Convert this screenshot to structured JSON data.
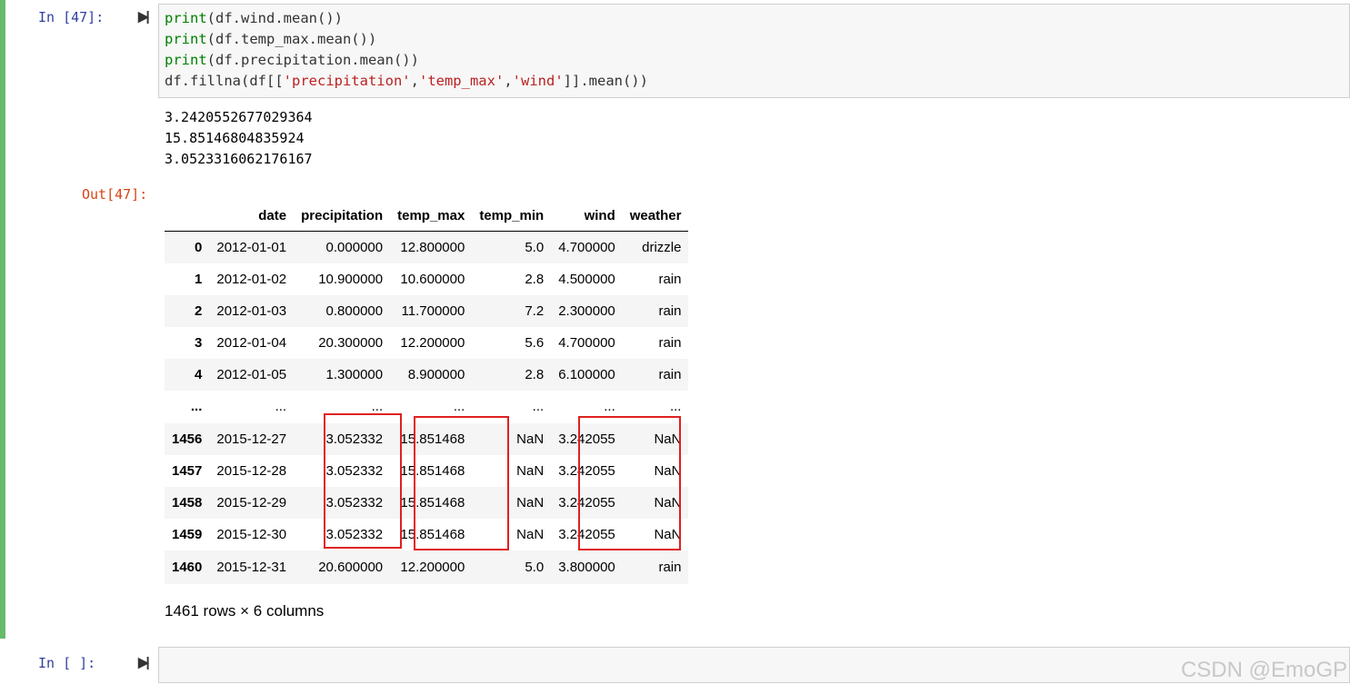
{
  "cell1": {
    "prompt_in": "In  [47]:",
    "prompt_out": "Out[47]:",
    "run_icon": "run-cell-icon",
    "code": {
      "line1": {
        "fn": "print",
        "rest": "(df.wind.mean())"
      },
      "line2": {
        "fn": "print",
        "rest": "(df.temp_max.mean())"
      },
      "line3": {
        "fn": "print",
        "rest": "(df.precipitation.mean())"
      },
      "line4": {
        "p1": "df.fillna(df[[",
        "s1": "'precipitation'",
        "c1": ",",
        "s2": "'temp_max'",
        "c2": ",",
        "s3": "'wind'",
        "p2": "]].mean())"
      }
    },
    "stdout": [
      "3.2420552677029364",
      "15.85146804835924",
      "3.0523316062176167"
    ],
    "table": {
      "columns": [
        "",
        "date",
        "precipitation",
        "temp_max",
        "temp_min",
        "wind",
        "weather"
      ],
      "rows": [
        [
          "0",
          "2012-01-01",
          "0.000000",
          "12.800000",
          "5.0",
          "4.700000",
          "drizzle"
        ],
        [
          "1",
          "2012-01-02",
          "10.900000",
          "10.600000",
          "2.8",
          "4.500000",
          "rain"
        ],
        [
          "2",
          "2012-01-03",
          "0.800000",
          "11.700000",
          "7.2",
          "2.300000",
          "rain"
        ],
        [
          "3",
          "2012-01-04",
          "20.300000",
          "12.200000",
          "5.6",
          "4.700000",
          "rain"
        ],
        [
          "4",
          "2012-01-05",
          "1.300000",
          "8.900000",
          "2.8",
          "6.100000",
          "rain"
        ],
        [
          "...",
          "...",
          "...",
          "...",
          "...",
          "...",
          "..."
        ],
        [
          "1456",
          "2015-12-27",
          "3.052332",
          "15.851468",
          "NaN",
          "3.242055",
          "NaN"
        ],
        [
          "1457",
          "2015-12-28",
          "3.052332",
          "15.851468",
          "NaN",
          "3.242055",
          "NaN"
        ],
        [
          "1458",
          "2015-12-29",
          "3.052332",
          "15.851468",
          "NaN",
          "3.242055",
          "NaN"
        ],
        [
          "1459",
          "2015-12-30",
          "3.052332",
          "15.851468",
          "NaN",
          "3.242055",
          "NaN"
        ],
        [
          "1460",
          "2015-12-31",
          "20.600000",
          "12.200000",
          "5.0",
          "3.800000",
          "rain"
        ]
      ]
    },
    "shape": "1461 rows × 6 columns"
  },
  "cell2": {
    "prompt_in": "In  [ ]:",
    "run_icon": "run-cell-icon"
  },
  "watermark": "CSDN @EmoGP",
  "colors": {
    "selected_bar": "#66bb6a",
    "prompt_in": "#303f9f",
    "prompt_out": "#d84315",
    "keyword": "#008000",
    "string": "#ba2121",
    "highlight_box": "#e02020"
  }
}
